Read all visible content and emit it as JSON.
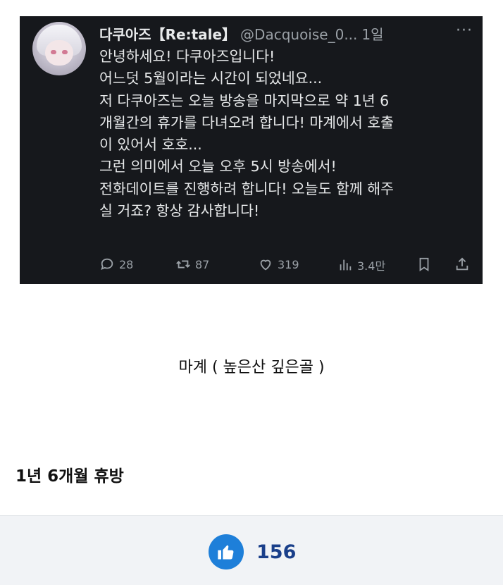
{
  "tweet": {
    "display_name": "다쿠아즈【Re:tale】",
    "handle": "@Dacquoise_0...",
    "time": "1일",
    "more": "···",
    "lines": [
      "안녕하세요! 다쿠아즈입니다!",
      "어느덧 5월이라는 시간이 되었네요...",
      "저 다쿠아즈는 오늘 방송을 마지막으로 약 1년 6",
      "개월간의 휴가를 다녀오려 합니다! 마계에서 호출",
      "이 있어서 호호...",
      "그런 의미에서 오늘 오후 5시 방송에서!",
      "전화데이트를 진행하려 합니다! 오늘도 함께 해주",
      "실 거죠? 항상 감사합니다!"
    ],
    "replies": "28",
    "retweets": "87",
    "likes": "319",
    "views": "3.4만"
  },
  "caption": "마계 ( 높은산 깊은골 )",
  "headline": "1년 6개월 휴방",
  "footer": {
    "like_count": "156"
  },
  "colors": {
    "tweet_bg": "#16181c",
    "like_blue": "#1e7fd9",
    "count_navy": "#1a3f8a"
  }
}
